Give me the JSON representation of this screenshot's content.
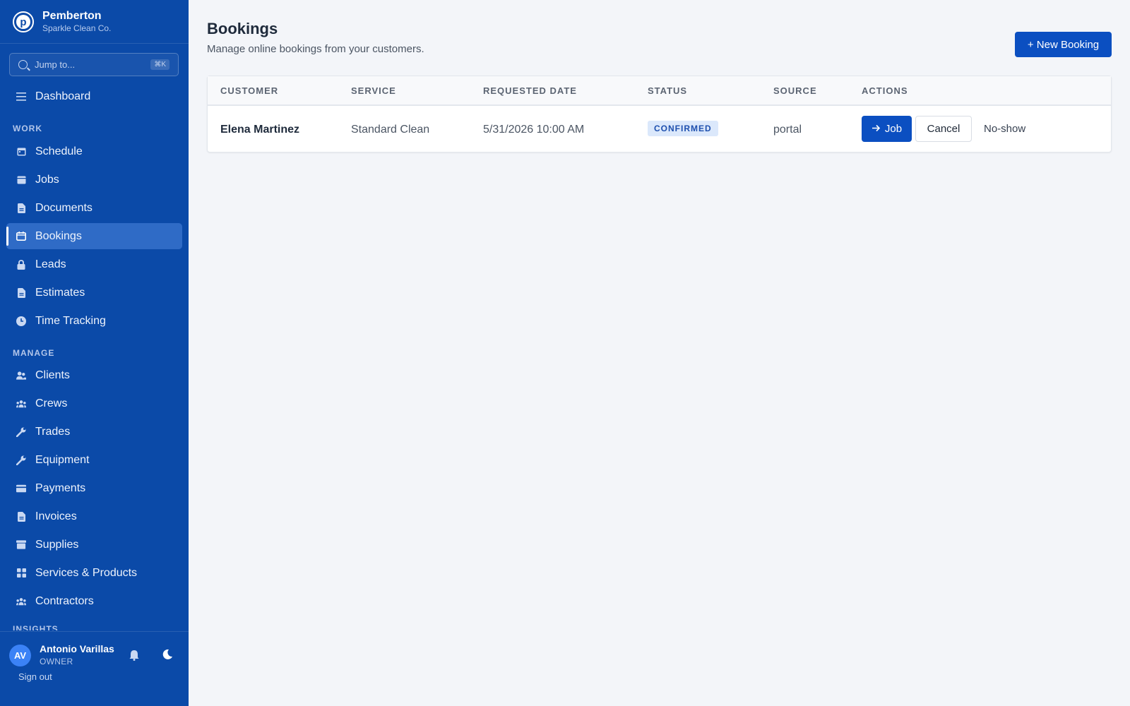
{
  "brand": {
    "name": "Pemberton",
    "subtitle": "Sparkle Clean Co.",
    "logo_letter": "p"
  },
  "search": {
    "placeholder": "Jump to...",
    "shortcut": "⌘K"
  },
  "nav": {
    "top": [
      {
        "label": "Dashboard",
        "icon": "menu-icon"
      }
    ],
    "work_label": "WORK",
    "work": [
      {
        "label": "Schedule",
        "icon": "calendar-icon"
      },
      {
        "label": "Jobs",
        "icon": "calendar-icon"
      },
      {
        "label": "Documents",
        "icon": "document-icon"
      },
      {
        "label": "Bookings",
        "icon": "calendar-icon",
        "active": true
      },
      {
        "label": "Leads",
        "icon": "lock-icon"
      },
      {
        "label": "Estimates",
        "icon": "document-icon"
      },
      {
        "label": "Time Tracking",
        "icon": "clock-icon"
      }
    ],
    "manage_label": "MANAGE",
    "manage": [
      {
        "label": "Clients",
        "icon": "users-icon"
      },
      {
        "label": "Crews",
        "icon": "group-icon"
      },
      {
        "label": "Trades",
        "icon": "wrench-icon"
      },
      {
        "label": "Equipment",
        "icon": "wrench-icon"
      },
      {
        "label": "Payments",
        "icon": "card-icon"
      },
      {
        "label": "Invoices",
        "icon": "document-icon"
      },
      {
        "label": "Supplies",
        "icon": "archive-icon"
      },
      {
        "label": "Services & Products",
        "icon": "grid-icon"
      },
      {
        "label": "Contractors",
        "icon": "group-icon"
      }
    ],
    "insights_label": "INSIGHTS"
  },
  "user": {
    "initials": "AV",
    "name": "Antonio Varillas",
    "role": "OWNER",
    "signout": "Sign out"
  },
  "page": {
    "title": "Bookings",
    "subtitle": "Manage online bookings from your customers.",
    "new_button": "+ New Booking"
  },
  "table": {
    "columns": [
      "CUSTOMER",
      "SERVICE",
      "REQUESTED DATE",
      "STATUS",
      "SOURCE",
      "ACTIONS"
    ],
    "rows": [
      {
        "customer": "Elena Martinez",
        "service": "Standard Clean",
        "requested_date": "5/31/2026 10:00 AM",
        "status": "CONFIRMED",
        "source": "portal",
        "actions": {
          "job": "Job",
          "cancel": "Cancel",
          "noshow": "No-show"
        }
      }
    ]
  },
  "colors": {
    "sidebar": "#0b4aa8",
    "accent": "#0b4fc1",
    "active_item": "#2f6bc6",
    "background": "#f3f5f9"
  }
}
